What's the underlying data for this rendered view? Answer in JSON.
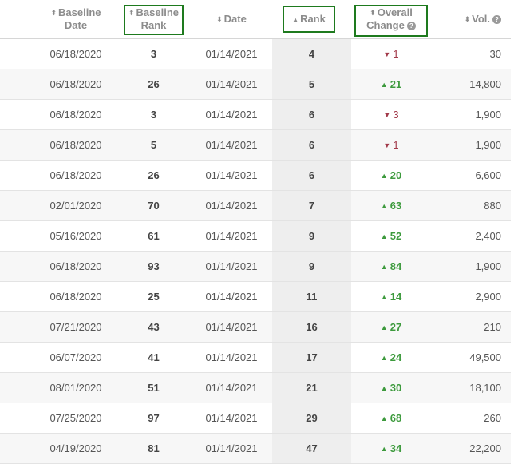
{
  "header": {
    "baseline_date": [
      "Baseline",
      "Date"
    ],
    "baseline_rank": [
      "Baseline",
      "Rank"
    ],
    "date": "Date",
    "rank": "Rank",
    "overall_change": [
      "Overall",
      "Change"
    ],
    "vol": "Vol."
  },
  "sort": {
    "column": "Rank",
    "direction": "ascending"
  },
  "colors": {
    "up": "#3d9a3d",
    "down": "#a23a4a",
    "highlight_box": "#1e7a1e"
  },
  "rows": [
    {
      "baseline_date": "06/18/2020",
      "baseline_rank": "3",
      "date": "01/14/2021",
      "rank": "4",
      "change_dir": "down",
      "change": "1",
      "vol": "30"
    },
    {
      "baseline_date": "06/18/2020",
      "baseline_rank": "26",
      "date": "01/14/2021",
      "rank": "5",
      "change_dir": "up",
      "change": "21",
      "vol": "14,800"
    },
    {
      "baseline_date": "06/18/2020",
      "baseline_rank": "3",
      "date": "01/14/2021",
      "rank": "6",
      "change_dir": "down",
      "change": "3",
      "vol": "1,900"
    },
    {
      "baseline_date": "06/18/2020",
      "baseline_rank": "5",
      "date": "01/14/2021",
      "rank": "6",
      "change_dir": "down",
      "change": "1",
      "vol": "1,900"
    },
    {
      "baseline_date": "06/18/2020",
      "baseline_rank": "26",
      "date": "01/14/2021",
      "rank": "6",
      "change_dir": "up",
      "change": "20",
      "vol": "6,600"
    },
    {
      "baseline_date": "02/01/2020",
      "baseline_rank": "70",
      "date": "01/14/2021",
      "rank": "7",
      "change_dir": "up",
      "change": "63",
      "vol": "880"
    },
    {
      "baseline_date": "05/16/2020",
      "baseline_rank": "61",
      "date": "01/14/2021",
      "rank": "9",
      "change_dir": "up",
      "change": "52",
      "vol": "2,400"
    },
    {
      "baseline_date": "06/18/2020",
      "baseline_rank": "93",
      "date": "01/14/2021",
      "rank": "9",
      "change_dir": "up",
      "change": "84",
      "vol": "1,900"
    },
    {
      "baseline_date": "06/18/2020",
      "baseline_rank": "25",
      "date": "01/14/2021",
      "rank": "11",
      "change_dir": "up",
      "change": "14",
      "vol": "2,900"
    },
    {
      "baseline_date": "07/21/2020",
      "baseline_rank": "43",
      "date": "01/14/2021",
      "rank": "16",
      "change_dir": "up",
      "change": "27",
      "vol": "210"
    },
    {
      "baseline_date": "06/07/2020",
      "baseline_rank": "41",
      "date": "01/14/2021",
      "rank": "17",
      "change_dir": "up",
      "change": "24",
      "vol": "49,500"
    },
    {
      "baseline_date": "08/01/2020",
      "baseline_rank": "51",
      "date": "01/14/2021",
      "rank": "21",
      "change_dir": "up",
      "change": "30",
      "vol": "18,100"
    },
    {
      "baseline_date": "07/25/2020",
      "baseline_rank": "97",
      "date": "01/14/2021",
      "rank": "29",
      "change_dir": "up",
      "change": "68",
      "vol": "260"
    },
    {
      "baseline_date": "04/19/2020",
      "baseline_rank": "81",
      "date": "01/14/2021",
      "rank": "47",
      "change_dir": "up",
      "change": "34",
      "vol": "22,200"
    }
  ]
}
